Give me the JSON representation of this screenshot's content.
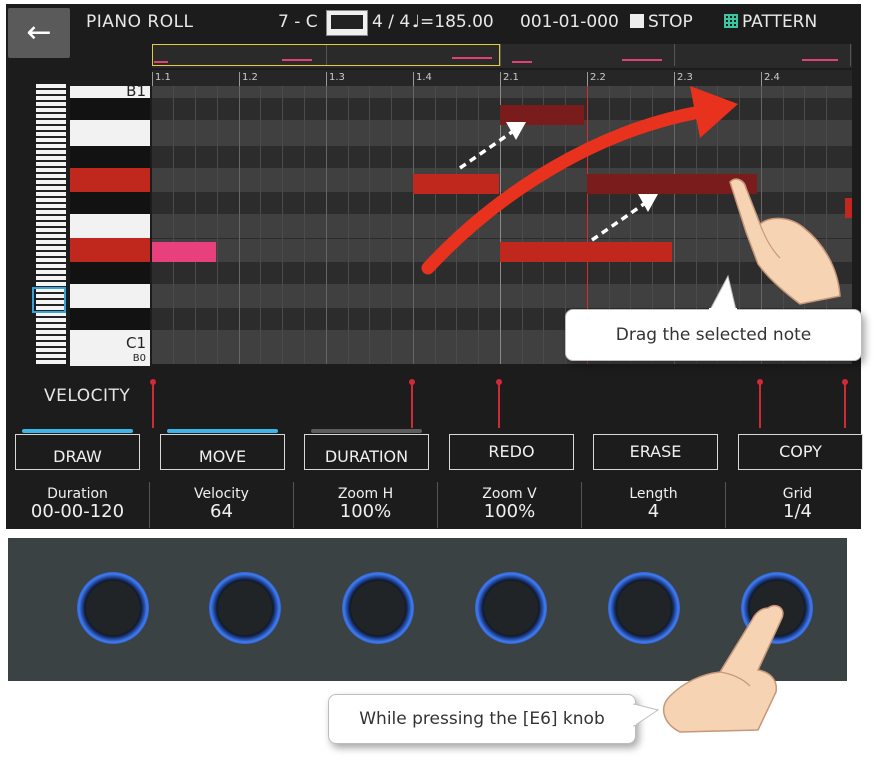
{
  "topbar": {
    "back_icon": "←",
    "title": "PIANO ROLL",
    "song": "7 - C",
    "time_signature": "4 / 4",
    "tempo": "♩=185.00",
    "position": "001-01-000",
    "transport": "STOP",
    "mode": "PATTERN"
  },
  "ruler": {
    "ticks": [
      "1.1",
      "1.2",
      "1.3",
      "1.4",
      "2.1",
      "2.2",
      "2.3",
      "2.4"
    ]
  },
  "keyboard": {
    "top_label": "B1",
    "bottom_label": "C1",
    "partial_label": "B0"
  },
  "velocity": {
    "label": "VELOCITY"
  },
  "function_buttons": [
    {
      "label": "DRAW",
      "state": "on"
    },
    {
      "label": "MOVE",
      "state": "on"
    },
    {
      "label": "DURATION",
      "state": "off"
    },
    {
      "label": "REDO"
    },
    {
      "label": "ERASE"
    },
    {
      "label": "COPY"
    }
  ],
  "params": [
    {
      "name": "Duration",
      "value": "00-00-120"
    },
    {
      "name": "Velocity",
      "value": "64"
    },
    {
      "name": "Zoom H",
      "value": "100%"
    },
    {
      "name": "Zoom V",
      "value": "100%"
    },
    {
      "name": "Length",
      "value": "4"
    },
    {
      "name": "Grid",
      "value": "1/4"
    }
  ],
  "callouts": {
    "drag_note": "Drag the selected note",
    "press_knob": "While pressing the [E6] knob"
  },
  "colors": {
    "note_red": "#c0281e",
    "note_dim": "#7a1c1c",
    "note_pink": "#e8407c",
    "accent_blue": "#3fb4e6",
    "arrow_red": "#e8321e"
  }
}
